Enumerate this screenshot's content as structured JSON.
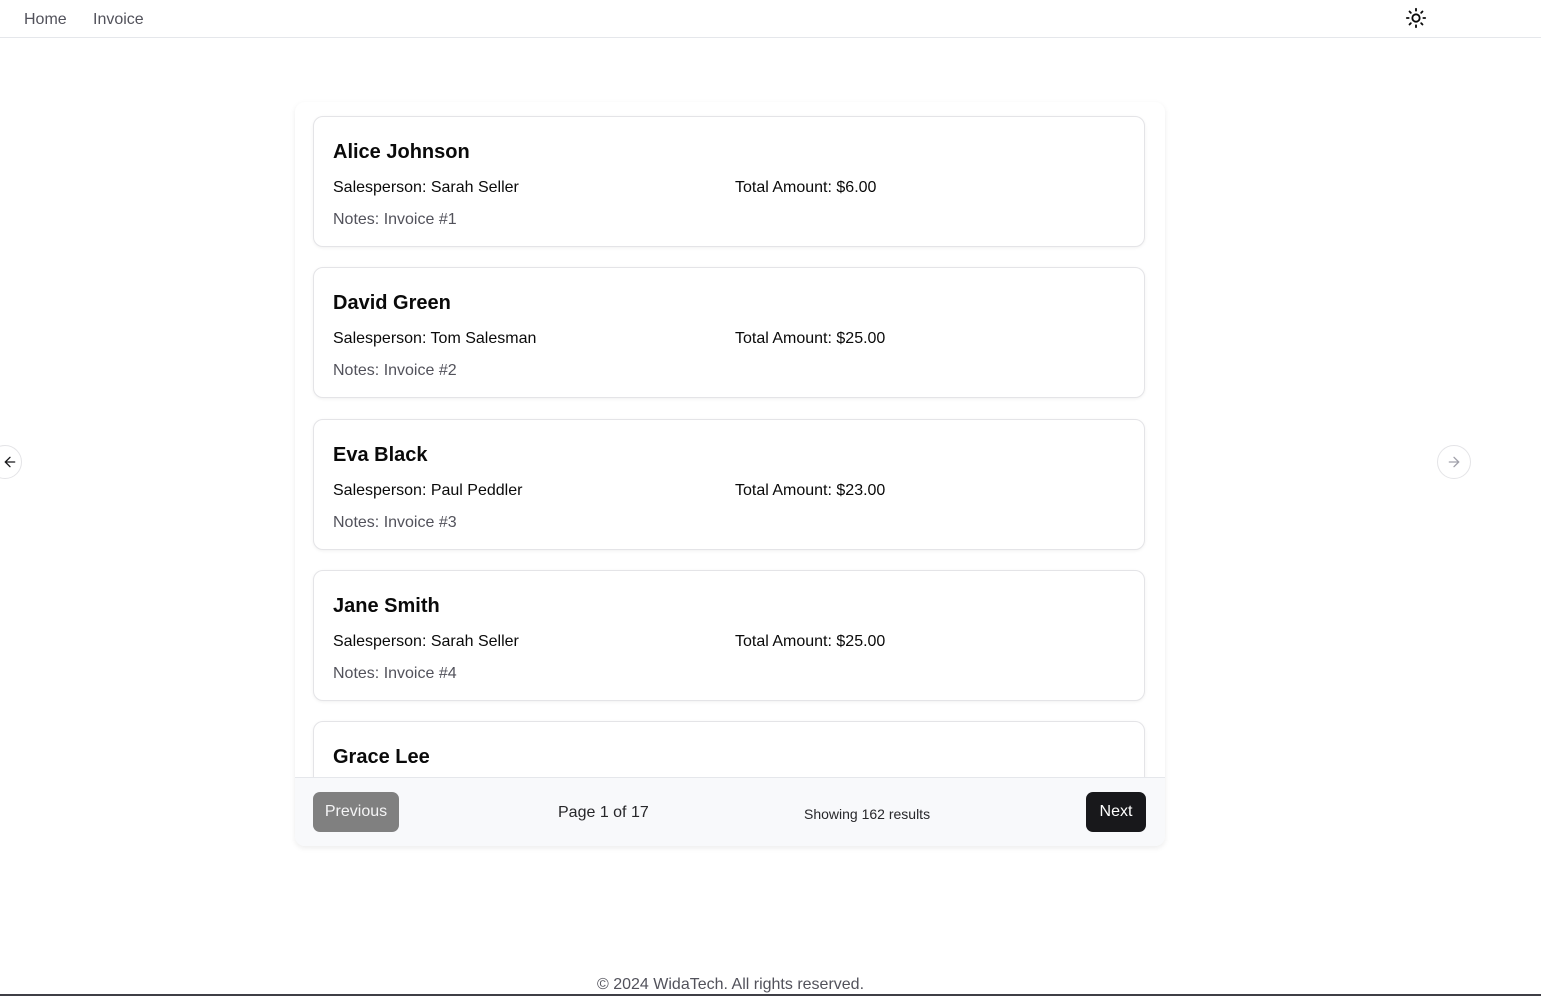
{
  "nav": {
    "home_label": "Home",
    "invoice_label": "Invoice",
    "theme_icon": "sun-icon"
  },
  "invoices": [
    {
      "customer": "Alice Johnson",
      "salesperson": "Salesperson: Sarah Seller",
      "total": "Total Amount: $6.00",
      "notes": "Notes: Invoice #1"
    },
    {
      "customer": "David Green",
      "salesperson": "Salesperson: Tom Salesman",
      "total": "Total Amount: $25.00",
      "notes": "Notes: Invoice #2"
    },
    {
      "customer": "Eva Black",
      "salesperson": "Salesperson: Paul Peddler",
      "total": "Total Amount: $23.00",
      "notes": "Notes: Invoice #3"
    },
    {
      "customer": "Jane Smith",
      "salesperson": "Salesperson: Sarah Seller",
      "total": "Total Amount: $25.00",
      "notes": "Notes: Invoice #4"
    },
    {
      "customer": "Grace Lee",
      "salesperson": "",
      "total": "",
      "notes": ""
    }
  ],
  "pagination": {
    "previous_label": "Previous",
    "page_text": "Page 1 of 17",
    "results_text": "Showing 162 results",
    "next_label": "Next"
  },
  "side_arrows": {
    "left_icon": "arrow-left-icon",
    "right_icon": "arrow-right-icon"
  },
  "footer": {
    "copyright": "© 2024 WidaTech. All rights reserved."
  },
  "colors": {
    "next_button_bg": "#18181b",
    "previous_button_bg": "#808080",
    "muted_text": "#52525b",
    "card_border": "#e4e4e7"
  }
}
